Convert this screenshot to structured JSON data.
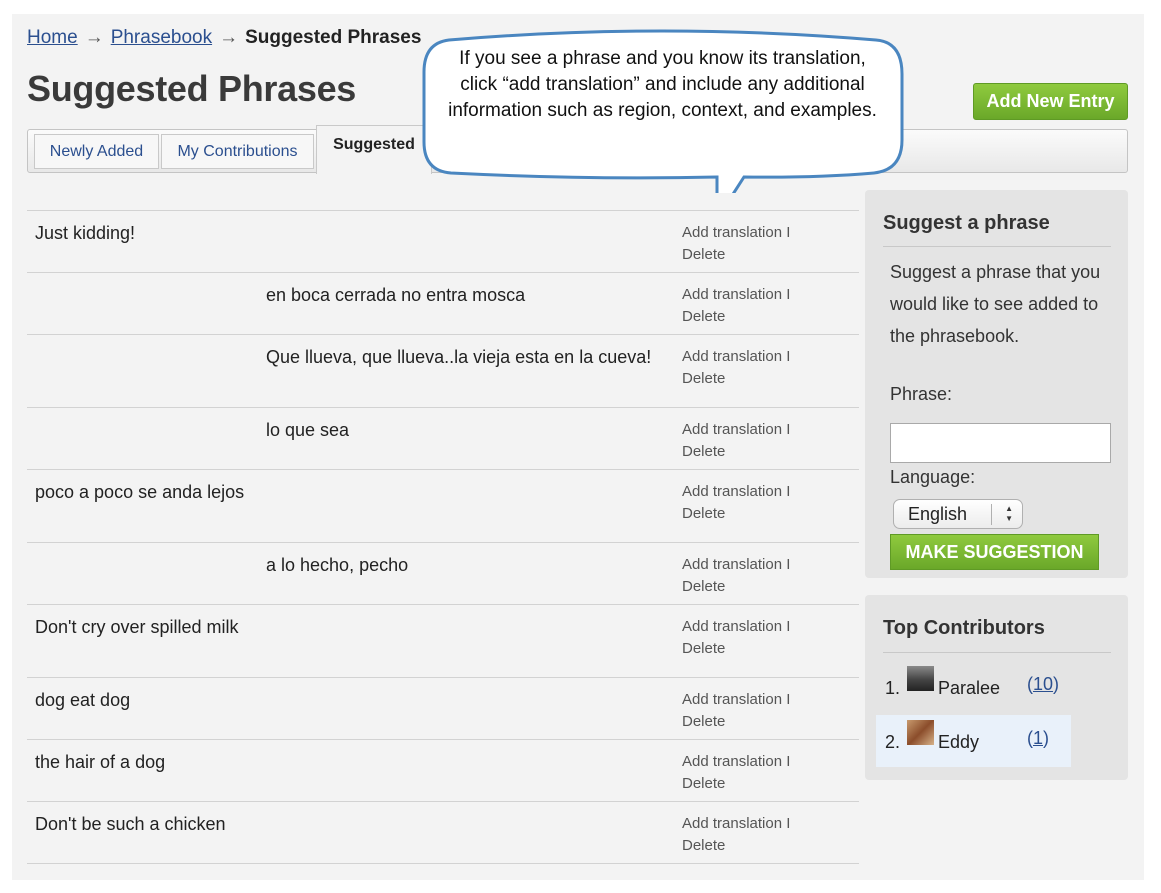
{
  "breadcrumb": {
    "home": "Home",
    "arrow": "→",
    "phrasebook": "Phrasebook",
    "current": "Suggested Phrases"
  },
  "page_title": "Suggested Phrases",
  "add_entry_label": "Add New Entry",
  "tabs": [
    {
      "label": "Newly Added",
      "active": false
    },
    {
      "label": "My Contributions",
      "active": false
    },
    {
      "label": "Suggested",
      "active": true
    }
  ],
  "callout": "If you see a phrase and you know its translation, click “add translation” and include any additional information such as region, context, and examples.",
  "row_actions": {
    "add": "Add translation I",
    "delete": "Delete"
  },
  "phrases": [
    {
      "english": "Just kidding!",
      "spanish": ""
    },
    {
      "english": "",
      "spanish": "en boca cerrada no entra mosca"
    },
    {
      "english": "",
      "spanish": "Que llueva, que llueva..la vieja esta en la cueva!"
    },
    {
      "english": "",
      "spanish": "lo que sea"
    },
    {
      "english": "poco a poco se anda lejos",
      "spanish": ""
    },
    {
      "english": "",
      "spanish": "a lo hecho, pecho"
    },
    {
      "english": "Don't cry over spilled milk",
      "spanish": ""
    },
    {
      "english": "dog eat dog",
      "spanish": ""
    },
    {
      "english": "the hair of a dog",
      "spanish": ""
    },
    {
      "english": "Don't be such a chicken",
      "spanish": ""
    }
  ],
  "suggest": {
    "title": "Suggest a phrase",
    "description": "Suggest a phrase that you would like to see added to the phrasebook.",
    "phrase_label": "Phrase:",
    "phrase_value": "",
    "language_label": "Language:",
    "language_value": "English",
    "button_label": "MAKE SUGGESTION"
  },
  "contributors": {
    "title": "Top Contributors",
    "items": [
      {
        "rank": "1.",
        "name": "Paralee",
        "count": "10"
      },
      {
        "rank": "2.",
        "name": "Eddy",
        "count": "1"
      }
    ]
  },
  "colors": {
    "accent_green": "#7cb934",
    "link_blue": "#2b4f8f",
    "callout_fill": "#ffffff",
    "callout_stroke": "#4a86c0",
    "highlight_row": "#e9f1fa"
  },
  "icons": {
    "select_arrow": "updown-arrow-icon",
    "avatar": "user-avatar-icon"
  }
}
